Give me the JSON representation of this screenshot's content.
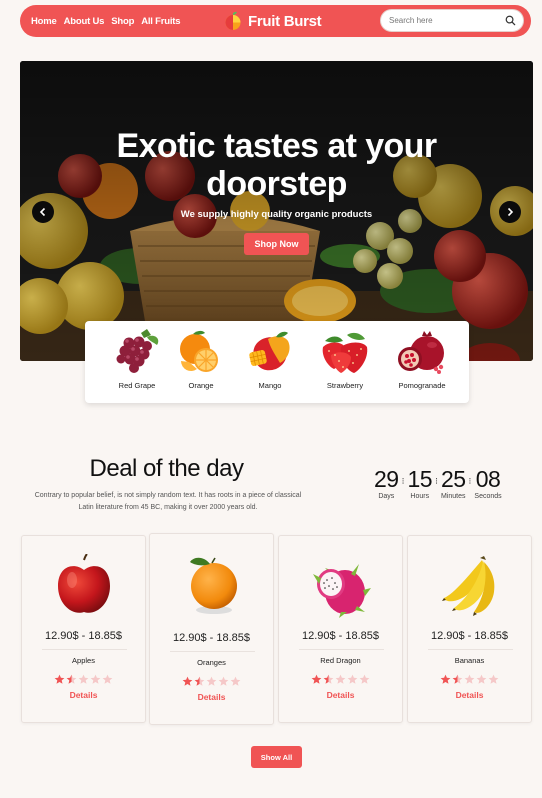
{
  "nav": {
    "links": [
      "Home",
      "About Us",
      "Shop",
      "All Fruits"
    ],
    "brand": "Fruit Burst",
    "search_placeholder": "Search here"
  },
  "hero": {
    "title_line1": "Exotic tastes at your",
    "title_line2": "doorstep",
    "subtitle": "We supply highly quality organic products",
    "cta": "Shop Now"
  },
  "categories": [
    {
      "label": "Red Grape",
      "icon": "grape-icon"
    },
    {
      "label": "Orange",
      "icon": "orange-icon"
    },
    {
      "label": "Mango",
      "icon": "mango-icon"
    },
    {
      "label": "Strawberry",
      "icon": "strawberry-icon"
    },
    {
      "label": "Pomogranade",
      "icon": "pomegranate-icon"
    }
  ],
  "deal": {
    "title": "Deal of the day",
    "text": "Contrary to popular belief, is not simply random text. It has roots in a piece of classical Latin literature from 45 BC, making it over 2000 years old.",
    "countdown": [
      {
        "value": "29",
        "label": "Days"
      },
      {
        "value": "15",
        "label": "Hours"
      },
      {
        "value": "25",
        "label": "Minutes"
      },
      {
        "value": "08",
        "label": "Seconds"
      }
    ]
  },
  "products": [
    {
      "name": "Apples",
      "price": "12.90$ - 18.85$",
      "rating": 1.5,
      "details": "Details"
    },
    {
      "name": "Oranges",
      "price": "12.90$ - 18.85$",
      "rating": 1.5,
      "details": "Details"
    },
    {
      "name": "Red Dragon",
      "price": "12.90$ - 18.85$",
      "rating": 1.5,
      "details": "Details"
    },
    {
      "name": "Bananas",
      "price": "12.90$ - 18.85$",
      "rating": 1.5,
      "details": "Details"
    }
  ],
  "show_all": "Show All",
  "colors": {
    "accent": "#f05454",
    "background": "#faf6f3",
    "star_empty": "#f5c8c8"
  }
}
